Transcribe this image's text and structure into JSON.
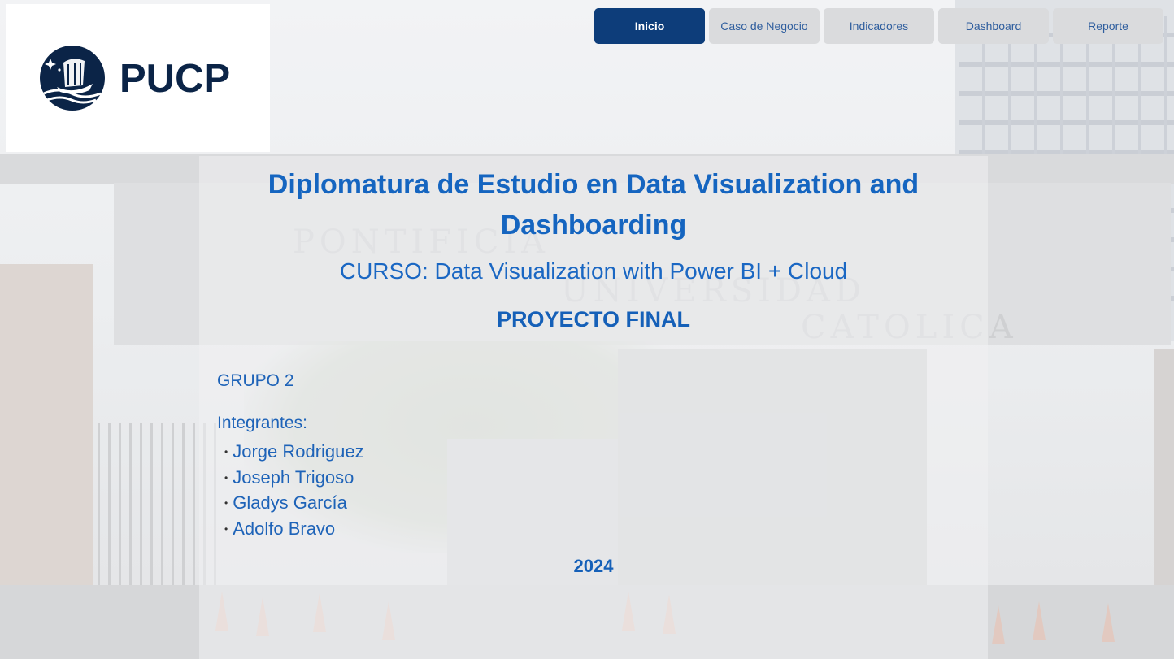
{
  "nav": {
    "items": [
      {
        "label": "Inicio",
        "active": true
      },
      {
        "label": "Caso de Negocio",
        "active": false
      },
      {
        "label": "Indicadores",
        "active": false
      },
      {
        "label": "Dashboard",
        "active": false
      },
      {
        "label": "Reporte",
        "active": false
      }
    ]
  },
  "logo": {
    "text": "PUCP",
    "icon": "pucp-ship-emblem-icon"
  },
  "main": {
    "title": "Diplomatura de Estudio en Data Visualization and Dashboarding",
    "course": "CURSO: Data Visualization with Power BI + Cloud",
    "project": "PROYECTO FINAL",
    "group": "GRUPO 2",
    "members_label": "Integrantes:",
    "members": [
      "Jorge Rodriguez",
      "Joseph Trigoso",
      "Gladys García",
      "Adolfo Bravo"
    ],
    "year": "2024"
  },
  "colors": {
    "nav_active": "#0d3d7a",
    "nav_inactive": "#dadbdd",
    "title_blue": "#1565c0",
    "logo_navy": "#0b2447"
  }
}
